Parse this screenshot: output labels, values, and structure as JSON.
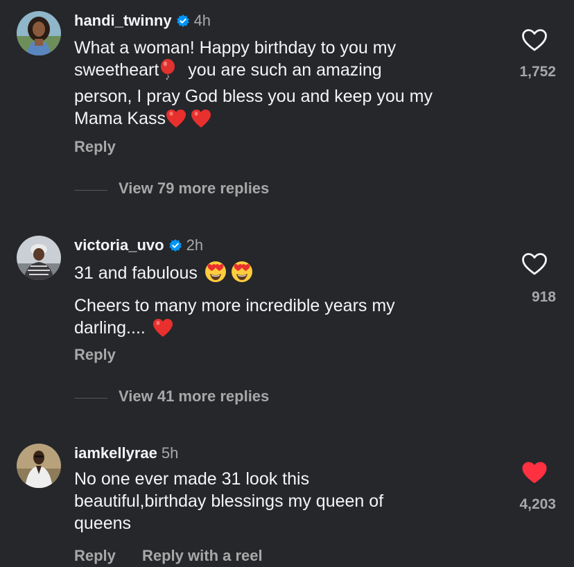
{
  "comments": [
    {
      "username": "handi_twinny",
      "verified": true,
      "time": "4h",
      "text_lines": [
        "What a woman! Happy birthday to you my",
        "sweetheart",
        "you are such an amazing",
        "person, I pray God bless you and keep you my",
        "Mama Kass"
      ],
      "emojis": [
        "balloon",
        "red-heart",
        "red-heart"
      ],
      "reply_label": "Reply",
      "view_replies": "View 79 more replies",
      "likes": "1,752",
      "liked": false
    },
    {
      "username": "victoria_uvo",
      "verified": true,
      "time": "2h",
      "text_lines": [
        "31 and fabulous",
        "Cheers to many more incredible years my",
        "darling...."
      ],
      "emojis": [
        "heart-eyes",
        "heart-eyes",
        "red-heart"
      ],
      "reply_label": "Reply",
      "view_replies": "View 41 more replies",
      "likes": "918",
      "liked": false
    },
    {
      "username": "iamkellyrae",
      "verified": false,
      "time": "5h",
      "text_lines": [
        "No one ever made 31 look this",
        "beautiful,birthday blessings my queen of",
        "queens"
      ],
      "emojis": [],
      "reply_label": "Reply",
      "reply_reel_label": "Reply with a reel",
      "likes": "4,203",
      "liked": true
    }
  ],
  "colors": {
    "background": "#25272b",
    "text": "#f3f5f7",
    "secondary": "#a8a8a8",
    "verified": "#0095f6",
    "liked": "#ff3040"
  }
}
